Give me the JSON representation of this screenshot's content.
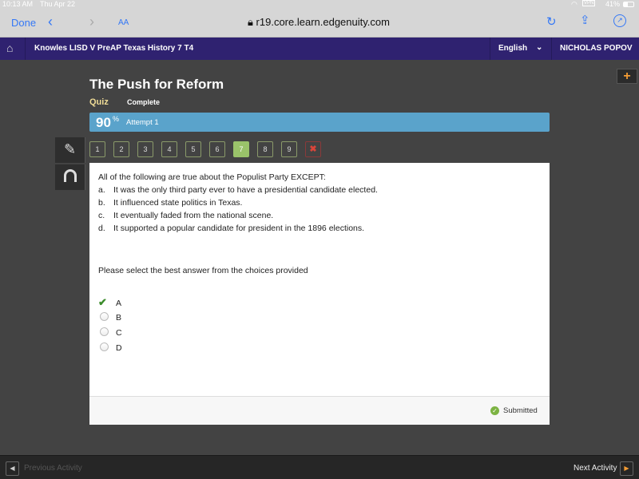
{
  "status": {
    "time": "10:13 AM",
    "date": "Thu Apr 22",
    "battery": "41%",
    "vpn": "VPN"
  },
  "browser": {
    "done": "Done",
    "text_size": "AA",
    "url": "r19.core.learn.edgenuity.com"
  },
  "nav": {
    "course": "Knowles LISD V PreAP Texas History 7 T4",
    "language": "English",
    "user": "NICHOLAS POPOV"
  },
  "lesson": {
    "title": "The Push for Reform",
    "type": "Quiz",
    "status": "Complete"
  },
  "score": {
    "value": "90",
    "unit": "%",
    "attempt": "Attempt 1"
  },
  "questions": [
    "1",
    "2",
    "3",
    "4",
    "5",
    "6",
    "7",
    "8",
    "9"
  ],
  "active_question": "7",
  "question": {
    "prompt": "All of the following are true about the Populist Party EXCEPT:",
    "options": [
      {
        "letter": "a.",
        "text": "It was the only third party ever to have a presidential candidate elected."
      },
      {
        "letter": "b.",
        "text": "It influenced state politics in Texas."
      },
      {
        "letter": "c.",
        "text": "It eventually faded from the national scene."
      },
      {
        "letter": "d.",
        "text": "It supported a popular candidate for president in the 1896 elections."
      }
    ],
    "instruction": "Please select the best answer from the choices provided",
    "choices": [
      "A",
      "B",
      "C",
      "D"
    ],
    "selected": "A"
  },
  "footer": {
    "status": "Submitted"
  },
  "bottom": {
    "prev": "Previous Activity",
    "next": "Next Activity"
  },
  "colors": {
    "nav": "#2f2270",
    "score_bar": "#5aa3cb",
    "active_question": "#9ac36a",
    "accent": "#f39c34",
    "correct": "#3c8c2c"
  }
}
